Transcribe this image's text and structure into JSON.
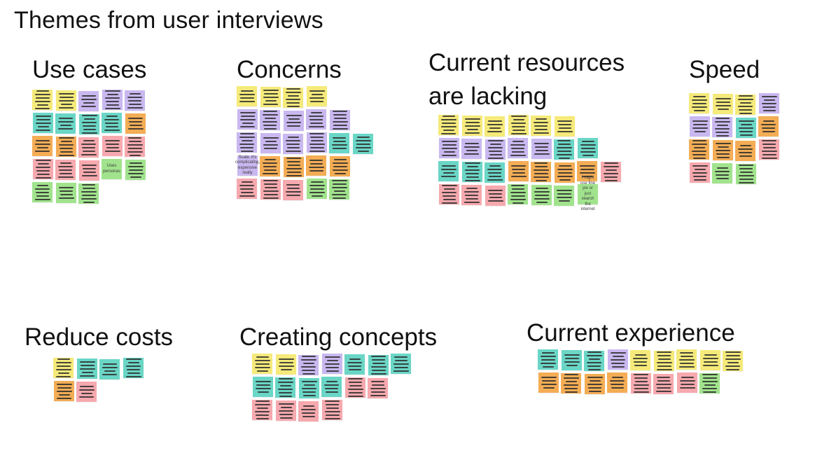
{
  "board": {
    "title": "Themes from user interviews"
  },
  "colors": {
    "yellow": "#f5ea7a",
    "purple": "#c9b8f0",
    "teal": "#6ad6c6",
    "orange": "#f4ad55",
    "pink": "#f6a9ae",
    "green": "#a1e38d"
  },
  "groups": [
    {
      "id": "use-cases",
      "title": "Use cases",
      "rows": [
        [
          "yellow",
          "yellow",
          "purple",
          "purple",
          "purple"
        ],
        [
          "teal",
          "teal",
          "teal",
          "teal",
          "orange"
        ],
        [
          "orange",
          "orange",
          "pink",
          "pink",
          "pink"
        ],
        [
          "pink",
          "pink",
          "pink",
          "green:Uses personas",
          "green"
        ],
        [
          "green",
          "green",
          "green"
        ]
      ]
    },
    {
      "id": "concerns",
      "title": "Concerns",
      "rows": [
        [
          "yellow",
          "yellow",
          "yellow",
          "yellow"
        ],
        [
          "purple",
          "purple",
          "purple",
          "purple",
          "purple"
        ],
        [
          "purple",
          "purple",
          "purple",
          "purple",
          "teal",
          "teal"
        ],
        [
          "purple:Scale, it's complicating, expensive really",
          "orange",
          "orange",
          "orange",
          "orange"
        ],
        [
          "pink",
          "pink",
          "pink",
          "green",
          "green"
        ]
      ]
    },
    {
      "id": "current-resources",
      "title": "Current resources\nare lacking",
      "rows": [
        [
          "yellow",
          "yellow",
          "yellow",
          "yellow",
          "yellow",
          "yellow"
        ],
        [
          "purple",
          "purple",
          "purple",
          "purple",
          "purple",
          "teal",
          "teal"
        ],
        [
          "teal",
          "teal",
          "teal",
          "orange",
          "orange",
          "orange",
          "orange",
          "pink"
        ],
        [
          "pink",
          "pink",
          "pink",
          "green",
          "green",
          "green",
          "green:I might use fine pix or just search the internet"
        ]
      ]
    },
    {
      "id": "speed",
      "title": "Speed",
      "rows": [
        [
          "yellow",
          "yellow",
          "yellow",
          "purple"
        ],
        [
          "purple",
          "purple",
          "teal",
          "orange"
        ],
        [
          "orange",
          "orange",
          "orange",
          "pink"
        ],
        [
          "pink",
          "green",
          "green"
        ]
      ]
    },
    {
      "id": "reduce-costs",
      "title": "Reduce costs",
      "rows": [
        [
          "yellow",
          "teal",
          "teal",
          "teal"
        ],
        [
          "orange",
          "pink"
        ]
      ]
    },
    {
      "id": "creating-concepts",
      "title": "Creating concepts",
      "rows": [
        [
          "yellow",
          "yellow",
          "purple",
          "purple",
          "teal",
          "teal",
          "teal"
        ],
        [
          "teal",
          "teal",
          "teal",
          "teal",
          "pink",
          "pink"
        ],
        [
          "pink",
          "pink",
          "pink",
          "pink"
        ]
      ]
    },
    {
      "id": "current-experience",
      "title": "Current experience",
      "rows": [
        [
          "teal",
          "teal",
          "teal",
          "purple",
          "yellow",
          "yellow",
          "yellow",
          "yellow",
          "yellow"
        ],
        [
          "orange",
          "orange",
          "orange",
          "orange",
          "pink",
          "pink",
          "pink",
          "green"
        ]
      ]
    }
  ]
}
